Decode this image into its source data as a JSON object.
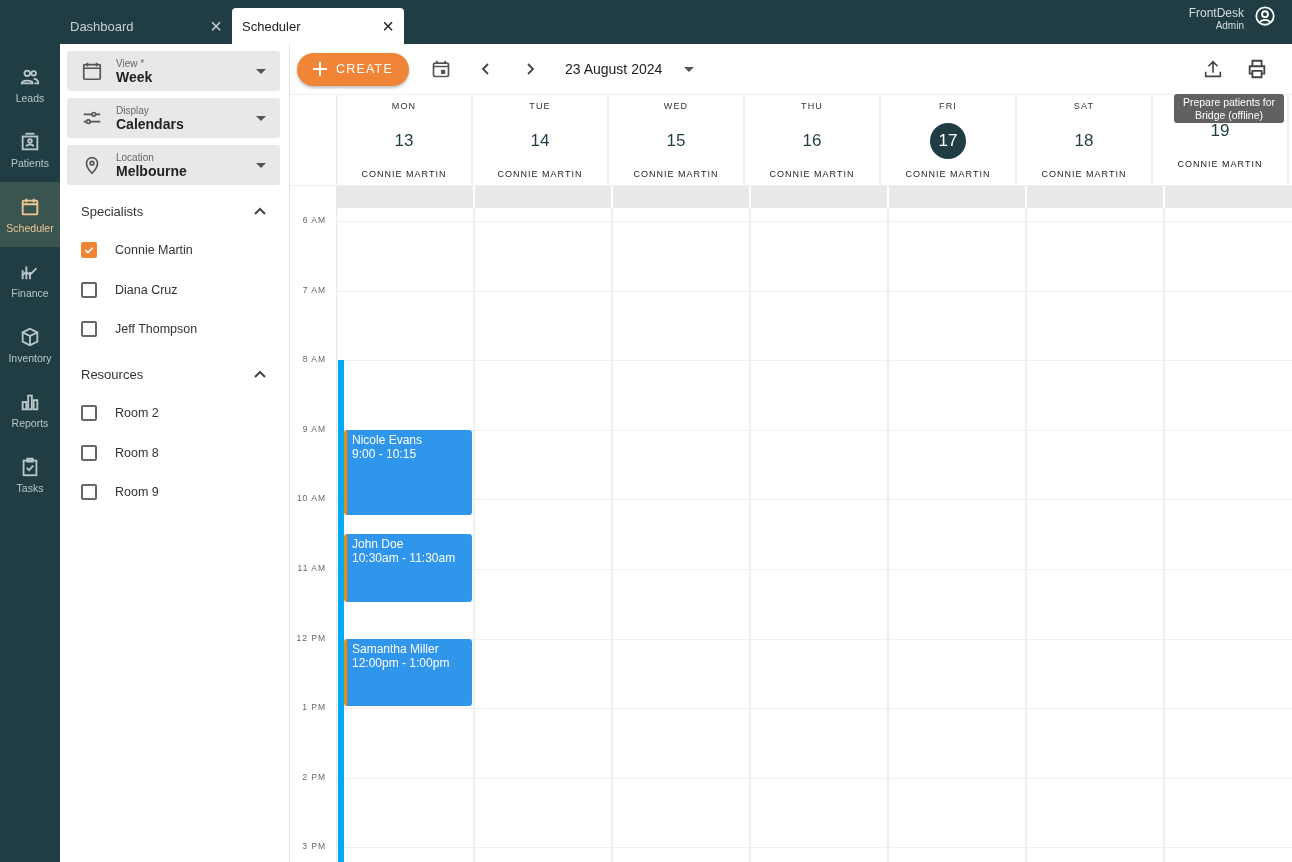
{
  "tabs": [
    {
      "label": "Dashboard",
      "selected": false,
      "close": "×"
    },
    {
      "label": "Scheduler",
      "selected": true,
      "close": "×"
    }
  ],
  "user": {
    "name": "FrontDesk",
    "role": "Admin"
  },
  "nav": [
    {
      "label": "Leads",
      "kind": "people",
      "selected": false
    },
    {
      "label": "Patients",
      "kind": "badge",
      "selected": false
    },
    {
      "label": "Scheduler",
      "kind": "calendar",
      "selected": true
    },
    {
      "label": "Finance",
      "kind": "chart",
      "selected": false
    },
    {
      "label": "Inventory",
      "kind": "box",
      "selected": false
    },
    {
      "label": "Reports",
      "kind": "bars",
      "selected": false
    },
    {
      "label": "Tasks",
      "kind": "clipboard",
      "selected": false
    }
  ],
  "filters": [
    {
      "label": "View *",
      "value": "Week",
      "kind": "calendar"
    },
    {
      "label": "Display",
      "value": "Calendars",
      "kind": "sliders"
    },
    {
      "label": "Location",
      "value": "Melbourne",
      "kind": "pin"
    }
  ],
  "groups": [
    {
      "title": "Specialists",
      "expanded": true,
      "items": [
        {
          "label": "Connie Martin",
          "checked": true
        },
        {
          "label": "Diana Cruz",
          "checked": false
        },
        {
          "label": "Jeff Thompson",
          "checked": false
        }
      ]
    },
    {
      "title": "Resources",
      "expanded": true,
      "items": [
        {
          "label": "Room 2",
          "checked": false
        },
        {
          "label": "Room 8",
          "checked": false
        },
        {
          "label": "Room 9",
          "checked": false
        }
      ]
    }
  ],
  "toolbar": {
    "create": "CREATE",
    "date": "23 August 2024",
    "tooltip": "Prepare patients for Bridge (offline)"
  },
  "days": [
    {
      "dow": "MON",
      "date": "13",
      "person": "CONNIE MARTIN",
      "selected": false
    },
    {
      "dow": "TUE",
      "date": "14",
      "person": "CONNIE MARTIN",
      "selected": false
    },
    {
      "dow": "WED",
      "date": "15",
      "person": "CONNIE MARTIN",
      "selected": false
    },
    {
      "dow": "THU",
      "date": "16",
      "person": "CONNIE MARTIN",
      "selected": false
    },
    {
      "dow": "FRI",
      "date": "17",
      "person": "CONNIE MARTIN",
      "selected": true
    },
    {
      "dow": "SAT",
      "date": "18",
      "person": "CONNIE MARTIN",
      "selected": false
    },
    {
      "date": "19",
      "person": "CONNIE MARTIN",
      "selected": false
    }
  ],
  "hours": [
    "6 AM",
    "7 AM",
    "8 AM",
    "9 AM",
    "10 AM",
    "11 AM",
    "12 PM",
    "1 PM",
    "2 PM",
    "3 PM"
  ],
  "events": [
    {
      "name": "Nicole Evans",
      "time": "9:00 - 10:15"
    },
    {
      "name": "John Doe",
      "time": "10:30am - 11:30am"
    },
    {
      "name": "Samantha Miller",
      "time": "12:00pm - 1:00pm"
    }
  ]
}
